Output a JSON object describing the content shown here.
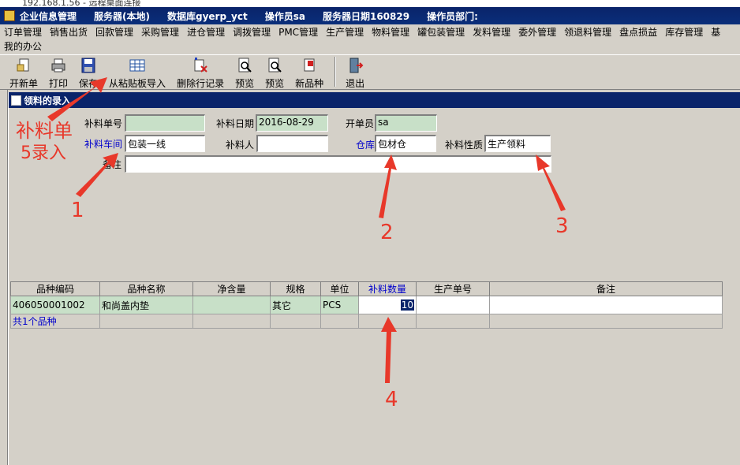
{
  "window": {
    "top_strip_text": "192.168.1.56 - 远程桌面连接",
    "title": "企业信息管理",
    "server": "服务器(本地)",
    "database": "数据库gyerp_yct",
    "operator": "操作员sa",
    "server_date": "服务器日期160829",
    "operator_dept": "操作员部门:"
  },
  "menu": {
    "row1": [
      "订单管理",
      "销售出货",
      "回款管理",
      "采购管理",
      "进仓管理",
      "调拨管理",
      "PMC管理",
      "生产管理",
      "物料管理",
      "罐包装管理",
      "发料管理",
      "委外管理",
      "领退料管理",
      "盘点损益",
      "库存管理",
      "基"
    ],
    "row2": [
      "我的办公"
    ]
  },
  "toolbar": {
    "buttons": [
      {
        "label": "开新单",
        "icon": "new-doc-icon"
      },
      {
        "label": "打印",
        "icon": "printer-icon"
      },
      {
        "label": "保存",
        "icon": "save-disk-icon"
      },
      {
        "label": "从粘贴板导入",
        "icon": "grid-import-icon"
      },
      {
        "label": "删除行记录",
        "icon": "delete-row-icon"
      },
      {
        "label": "预览",
        "icon": "preview-icon"
      },
      {
        "label": "预览",
        "icon": "preview-icon"
      },
      {
        "label": "新品种",
        "icon": "new-item-icon"
      },
      {
        "label": "退出",
        "icon": "exit-door-icon"
      }
    ]
  },
  "form": {
    "title": "领料的录入",
    "labels": {
      "doc_no": "补料单号",
      "doc_date": "补料日期",
      "creator": "开单员",
      "workshop": "补料车间",
      "person": "补料人",
      "warehouse": "仓库",
      "type": "补料性质",
      "remark": "备注"
    },
    "values": {
      "doc_no": "",
      "doc_date": "2016-08-29",
      "creator": "sa",
      "workshop": "包装一线",
      "person": "",
      "warehouse": "包材仓",
      "type": "生产领料",
      "remark": ""
    }
  },
  "grid": {
    "columns": [
      "品种编码",
      "品种名称",
      "净含量",
      "规格",
      "单位",
      "补料数量",
      "生产单号",
      "备注"
    ],
    "rows": [
      {
        "code": "406050001002",
        "name": "和尚盖内垫",
        "net": "",
        "spec": "其它",
        "unit": "PCS",
        "qty": "10",
        "order_no": "",
        "remark": ""
      }
    ],
    "footer": "共1个品种"
  },
  "annotations": {
    "callout": "补料单",
    "callout2": "5录入",
    "n1": "1",
    "n2": "2",
    "n3": "3",
    "n4": "4",
    "color": "#e8382a"
  }
}
